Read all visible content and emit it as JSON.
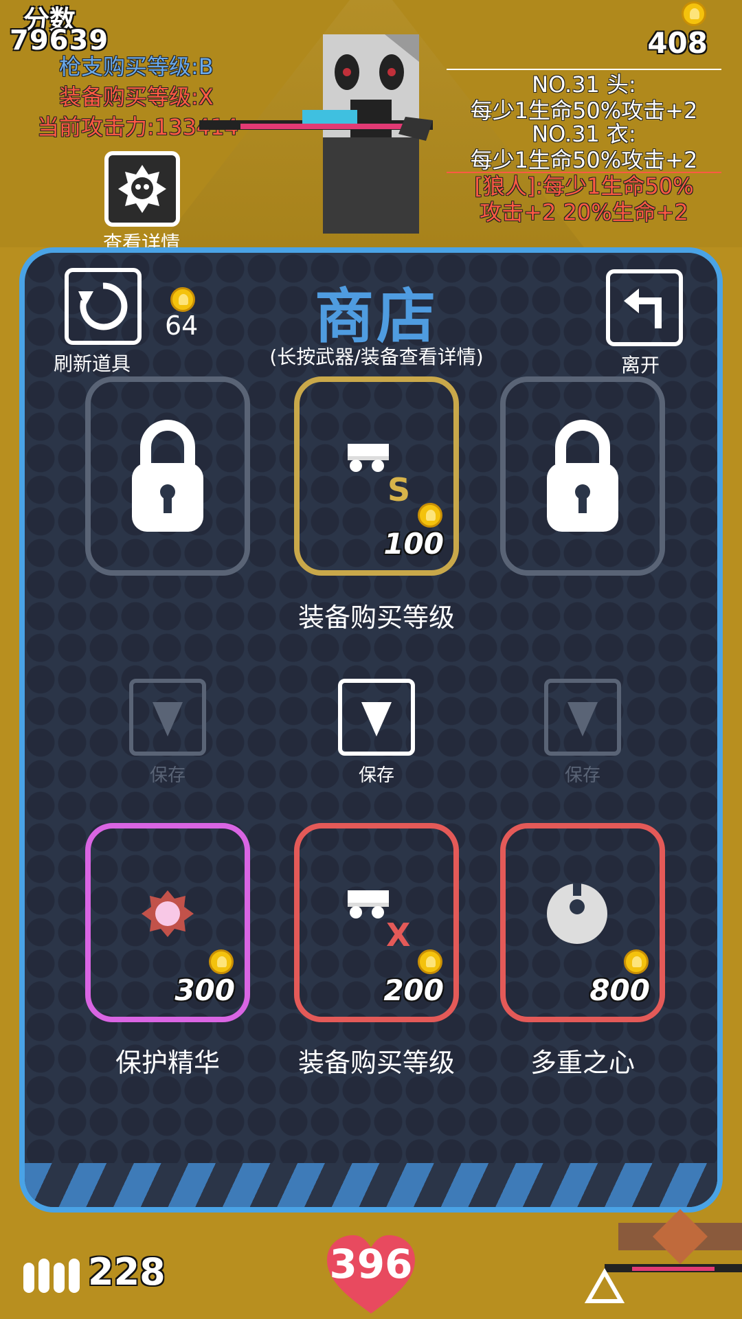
{
  "hud": {
    "score_label": "分数",
    "score_value": "79639",
    "gun_level": "枪支购买等级:B",
    "equip_level": "装备购买等级:X",
    "attack_power": "当前攻击力:133414",
    "coins": "408",
    "buffs": [
      "NO.31 头:\n每少1生命50%攻击+2",
      "NO.31 衣:\n每少1生命50%攻击+2",
      "[狼人]:每少1生命50%\n攻击+2 20%生命+2"
    ],
    "view_details_label": "查看详情"
  },
  "shop": {
    "title": "商店",
    "subtitle": "(长按武器/装备查看详情)",
    "refresh_label": "刷新道具",
    "refresh_cost": "64",
    "leave_label": "离开",
    "top_slots": [
      {
        "state": "locked"
      },
      {
        "state": "equipment-upgrade",
        "grade": "S",
        "price": "100",
        "label": "装备购买等级"
      },
      {
        "state": "locked"
      }
    ],
    "save_label": "保存",
    "bottom_slots": [
      {
        "icon": "protection-essence-icon",
        "price": "300",
        "label": "保护精华"
      },
      {
        "icon": "equipment-upgrade-icon",
        "grade": "X",
        "price": "200",
        "label": "装备购买等级"
      },
      {
        "icon": "multi-heart-icon",
        "price": "800",
        "label": "多重之心"
      }
    ]
  },
  "bottom_hud": {
    "ammo": "228",
    "health": "396"
  }
}
